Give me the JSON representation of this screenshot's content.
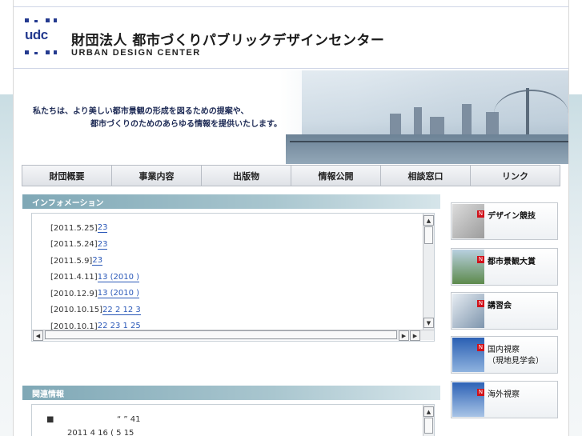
{
  "header": {
    "logo_text": "udc",
    "org_name": "財団法人 都市づくりパブリックデザインセンター",
    "org_name_en": "URBAN DESIGN CENTER"
  },
  "banner": {
    "tagline_1": "私たちは、より美しい都市景観の形成を図るための提案や、",
    "tagline_2": "都市づくりのためのあらゆる情報を提供いたします。"
  },
  "nav": {
    "items": [
      "財団概要",
      "事業内容",
      "出版物",
      "情報公開",
      "相談窓口",
      "リンク"
    ]
  },
  "information": {
    "title": "インフォメーション",
    "items": [
      {
        "date": "[2011.5.25]",
        "text": " 23                 "
      },
      {
        "date": "[2011.5.24]",
        "text": " 23             "
      },
      {
        "date": "[2011.5.9]",
        "text": " 23             "
      },
      {
        "date": "[2011.4.11]",
        "text": " 13 (2010 )             "
      },
      {
        "date": "[2010.12.9]",
        "text": " 13 (2010 )  "
      },
      {
        "date": "[2010.10.15]",
        "text": " 22    2                     12 3      "
      },
      {
        "date": "[2010.10.1]",
        "text": " 22                          23 1 25    "
      }
    ]
  },
  "related": {
    "title": "関連情報",
    "line_1": "“  ” 41",
    "line_2": "2011 4 16 (   5 15"
  },
  "side_links": [
    {
      "label": "デザイン競技",
      "label2": "",
      "icon": "design-competition-image"
    },
    {
      "label": "都市景観大賞",
      "label2": "",
      "icon": "landscape-award-image"
    },
    {
      "label": "講習会",
      "label2": "",
      "icon": "seminar-image"
    },
    {
      "label": "国内視察",
      "label2": "（現地見学会）",
      "icon": "domestic-tour-image"
    },
    {
      "label": "海外視察",
      "label2": "",
      "icon": "overseas-tour-image"
    }
  ],
  "colors": {
    "accent": "#243a8f",
    "link": "#2a58b8",
    "marker": "#d0121b",
    "panel_header": "#7fa8b6"
  }
}
